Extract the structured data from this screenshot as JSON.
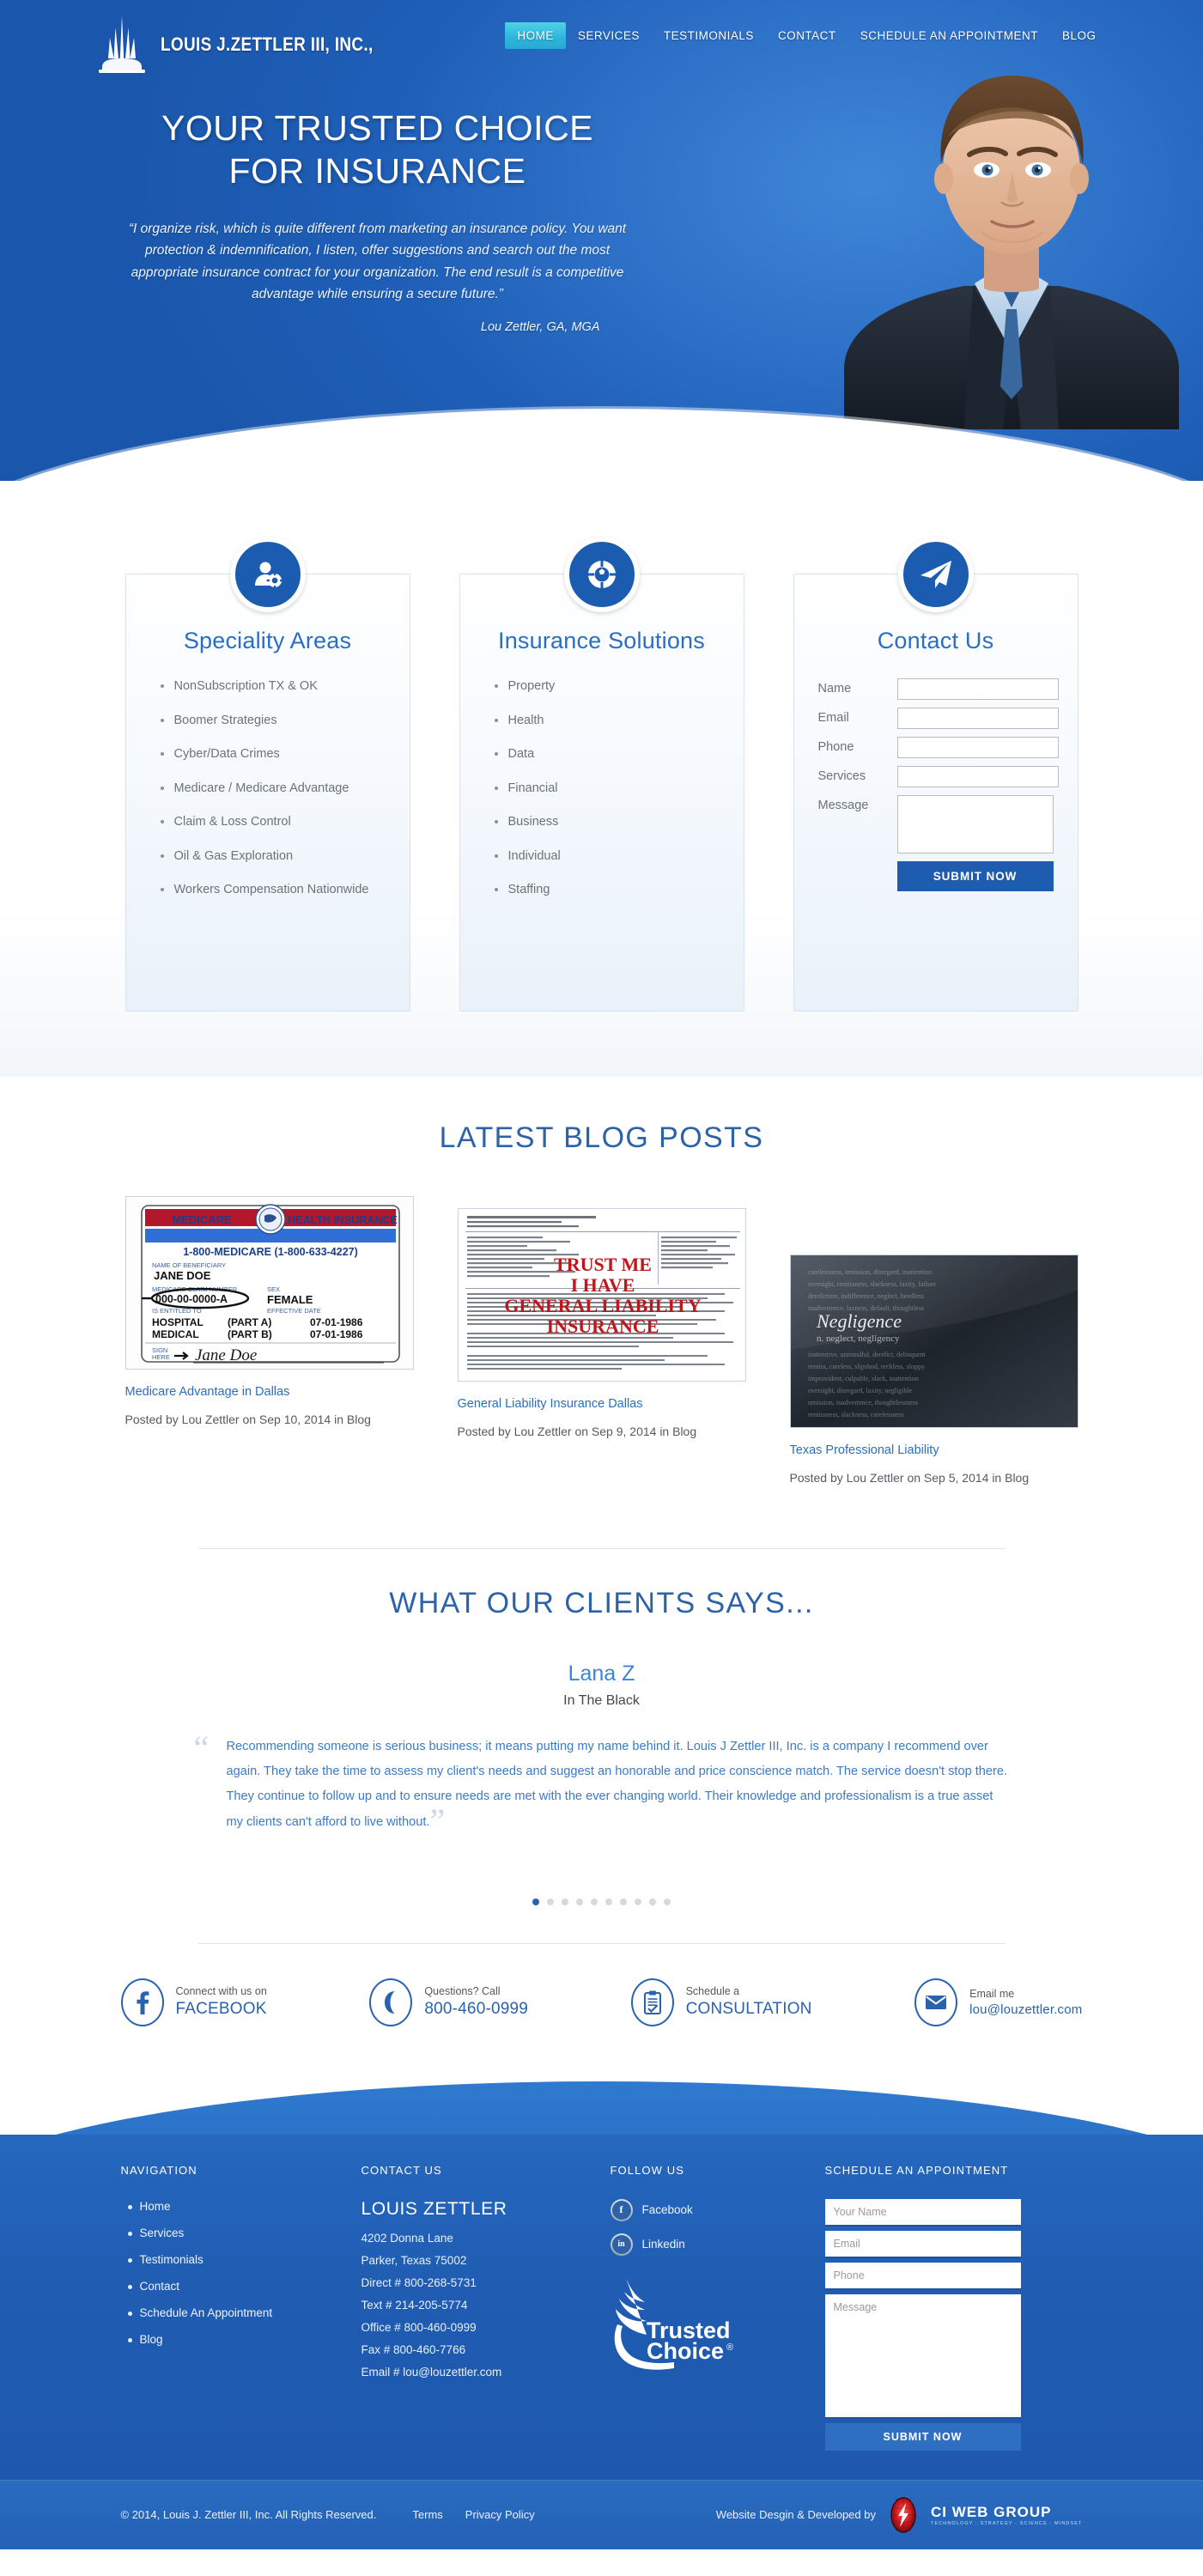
{
  "header": {
    "logo_text": "LOUIS J.ZETTLER III, INC.,",
    "logo_icon": "obelisk-tower-icon",
    "nav": [
      {
        "label": "HOME",
        "active": true
      },
      {
        "label": "SERVICES",
        "active": false
      },
      {
        "label": "TESTIMONIALS",
        "active": false
      },
      {
        "label": "CONTACT",
        "active": false
      },
      {
        "label": "SCHEDULE AN APPOINTMENT",
        "active": false
      },
      {
        "label": "BLOG",
        "active": false
      }
    ]
  },
  "hero": {
    "title": "YOUR TRUSTED CHOICE FOR INSURANCE",
    "quote": "“I organize risk, which is quite different from marketing an insurance policy. You want protection & indemnification, I listen, offer suggestions and search out the most appropriate insurance contract for your organization. The end result is a competitive advantage while ensuring a secure future.”",
    "attribution": "Lou Zettler, GA, MGA"
  },
  "cards": [
    {
      "title": "Speciality Areas",
      "icon": "person-gear-icon",
      "items": [
        "NonSubscription TX & OK",
        "Boomer Strategies",
        "Cyber/Data Crimes",
        "Medicare / Medicare Advantage",
        "Claim & Loss Control",
        "Oil & Gas Exploration",
        "Workers Compensation Nationwide"
      ]
    },
    {
      "title": "Insurance Solutions",
      "icon": "life-ring-icon",
      "items": [
        "Property",
        "Health",
        "Data",
        "Financial",
        "Business",
        "Individual",
        "Staffing"
      ]
    },
    {
      "title": "Contact Us",
      "icon": "paper-plane-icon",
      "form": {
        "fields": [
          {
            "label": "Name",
            "value": "",
            "type": "text"
          },
          {
            "label": "Email",
            "value": "",
            "type": "text"
          },
          {
            "label": "Phone",
            "value": "",
            "type": "text"
          },
          {
            "label": "Services",
            "value": "",
            "type": "text"
          },
          {
            "label": "Message",
            "value": "",
            "type": "textarea"
          }
        ],
        "submit_label": "SUBMIT NOW"
      }
    }
  ],
  "blog": {
    "heading": "LATEST BLOG POSTS",
    "posts": [
      {
        "title": "Medicare Advantage in Dallas",
        "meta": "Posted by Lou Zettler on Sep 10, 2014 in Blog",
        "thumb": "medicare-card-image",
        "thumb_text": {
          "left_header": "MEDICARE",
          "right_header": "HEALTH INSURANCE",
          "phone": "1-800-MEDICARE (1-800-633-4227)",
          "name_label": "NAME OF BENEFICIARY",
          "name_value": "JANE DOE",
          "claim_label": "MEDICARE CLAIM NUMBER",
          "claim_value": "000-00-0000-A",
          "sex_label": "SEX",
          "sex_value": "FEMALE",
          "entitled_label": "IS ENTITLED TO",
          "effective_label": "EFFECTIVE DATE",
          "row1": [
            "HOSPITAL",
            "(PART A)",
            "07-01-1986"
          ],
          "row2": [
            "MEDICAL",
            "(PART B)",
            "07-01-1986"
          ],
          "sign_label": "SIGN HERE",
          "signature": "Jane Doe"
        }
      },
      {
        "title": "General Liability Insurance Dallas",
        "meta": "Posted by Lou Zettler on Sep 9, 2014 in Blog",
        "thumb": "general-liability-form-image",
        "thumb_text": {
          "stamp_lines": [
            "TRUST ME",
            "I HAVE",
            "GENERAL LIABILITY",
            "INSURANCE"
          ]
        }
      },
      {
        "title": "Texas Professional Liability",
        "meta": "Posted by Lou Zettler on Sep 5, 2014 in Blog",
        "thumb": "negligence-dictionary-image",
        "thumb_text": {
          "focus_word": "Negligence"
        }
      }
    ]
  },
  "testimonials": {
    "heading": "WHAT OUR CLIENTS SAYS...",
    "name": "Lana Z",
    "role": "In The Black",
    "quote": "Recommending someone is serious business; it means putting my name behind it. Louis J Zettler III, Inc. is a company I recommend over again. They take the time to assess my client's needs and suggest an honorable and price conscience match. The service doesn't stop there. They continue to follow up and to ensure needs are met with the ever changing world. Their knowledge and professionalism is a true asset my clients can't afford to live without.",
    "dot_count": 10,
    "active_dot": 0
  },
  "contact_strip": [
    {
      "icon": "facebook-icon",
      "top": "Connect with us on",
      "main": "FACEBOOK",
      "small": false
    },
    {
      "icon": "phone-icon",
      "top": "Questions? Call",
      "main": "800-460-0999",
      "small": false
    },
    {
      "icon": "clipboard-check-icon",
      "top": "Schedule a",
      "main": "CONSULTATION",
      "small": false
    },
    {
      "icon": "envelope-icon",
      "top": "Email me",
      "main": "lou@louzettler.com",
      "small": true
    }
  ],
  "footer": {
    "navigation": {
      "heading": "NAVIGATION",
      "items": [
        "Home",
        "Services",
        "Testimonials",
        "Contact",
        "Schedule An Appointment",
        "Blog"
      ]
    },
    "contact": {
      "heading": "CONTACT US",
      "name": "LOUIS ZETTLER",
      "lines": [
        "4202 Donna Lane",
        "Parker, Texas 75002",
        "Direct # 800-268-5731",
        "Text # 214-205-5774",
        "Office # 800-460-0999",
        "Fax # 800-460-7766",
        "Email # lou@louzettler.com"
      ]
    },
    "follow": {
      "heading": "FOLLOW US",
      "socials": [
        {
          "icon": "facebook-icon",
          "label": "Facebook",
          "glyph": "f"
        },
        {
          "icon": "linkedin-icon",
          "label": "Linkedin",
          "glyph": "in"
        }
      ],
      "badge": {
        "line1": "Trusted",
        "line2": "Choice",
        "mark": "®",
        "icon": "trusted-choice-eagle-icon"
      }
    },
    "schedule": {
      "heading": "SCHEDULE AN APPOINTMENT",
      "fields": [
        {
          "placeholder": "Your Name",
          "value": "",
          "type": "text"
        },
        {
          "placeholder": "Email",
          "value": "",
          "type": "text"
        },
        {
          "placeholder": "Phone",
          "value": "",
          "type": "text"
        },
        {
          "placeholder": "Message",
          "value": "",
          "type": "textarea"
        }
      ],
      "submit_label": "SUBMIT NOW"
    },
    "bottom": {
      "copyright": "© 2014, Louis J. Zettler III, Inc. All Rights Reserved.",
      "links": [
        "Terms",
        "Privacy Policy"
      ],
      "credit_text": "Website Desgin & Developed by",
      "credit_brand": "CI WEB GROUP",
      "credit_sub": "TECHNOLOGY · STRATEGY · SCIENCE · MINDSET",
      "credit_icon": "ci-web-group-logo"
    }
  },
  "colors": {
    "brand_blue": "#1d5cae",
    "accent_cyan": "#2fb6dd",
    "link_blue": "#2a6ec4",
    "hero_blue": "#2467bf",
    "text_gray": "#6d7278"
  }
}
